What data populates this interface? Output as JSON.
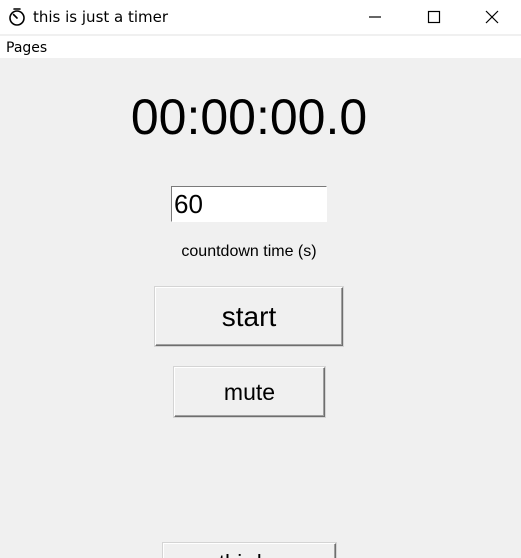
{
  "window": {
    "title": "this is just a timer",
    "controls": {
      "minimize_icon": "minimize-icon",
      "maximize_icon": "maximize-icon",
      "close_icon": "close-icon"
    },
    "app_icon": "timer-icon"
  },
  "menubar": {
    "items": [
      {
        "label": "Pages"
      }
    ]
  },
  "timer": {
    "display": "00:00:00.0"
  },
  "countdown": {
    "input_value": "60",
    "label": "countdown time (s)"
  },
  "buttons": {
    "start_label": "start",
    "mute_label": "mute",
    "bottom_label": "third p"
  }
}
